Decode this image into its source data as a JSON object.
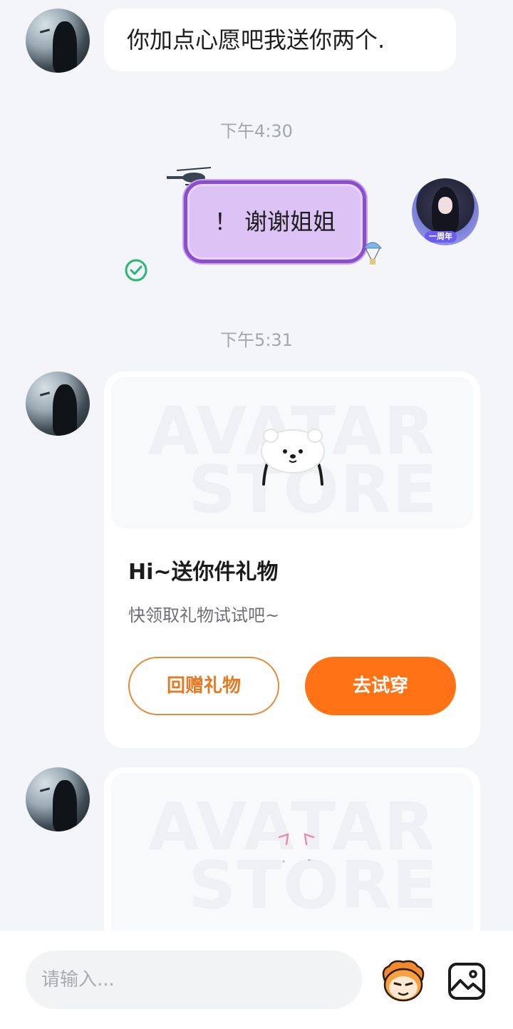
{
  "messages": {
    "incoming_1": {
      "text": "你加点心愿吧我送你两个."
    },
    "time_1": "下午4:30",
    "outgoing_1": {
      "text": "！ 谢谢姐姐",
      "avatar_tag": "一周年"
    },
    "time_2": "下午5:31",
    "gift_card_1": {
      "watermark_line1": "AVATAR",
      "watermark_line2": "STORE",
      "title": "Hi~送你件礼物",
      "subtitle": "快领取礼物试试吧~",
      "return_gift_label": "回赠礼物",
      "try_on_label": "去试穿"
    },
    "gift_card_2": {
      "watermark_line1": "AVATAR",
      "watermark_line2": "STORE"
    }
  },
  "input": {
    "placeholder": "请输入..."
  },
  "icons": {
    "sent_status": "check-circle-icon",
    "emoji": "emoji-mascot-icon",
    "image": "image-icon"
  },
  "colors": {
    "accent": "#ff7316",
    "check": "#2bb673",
    "bubble_purple": "#ddc2f6"
  }
}
